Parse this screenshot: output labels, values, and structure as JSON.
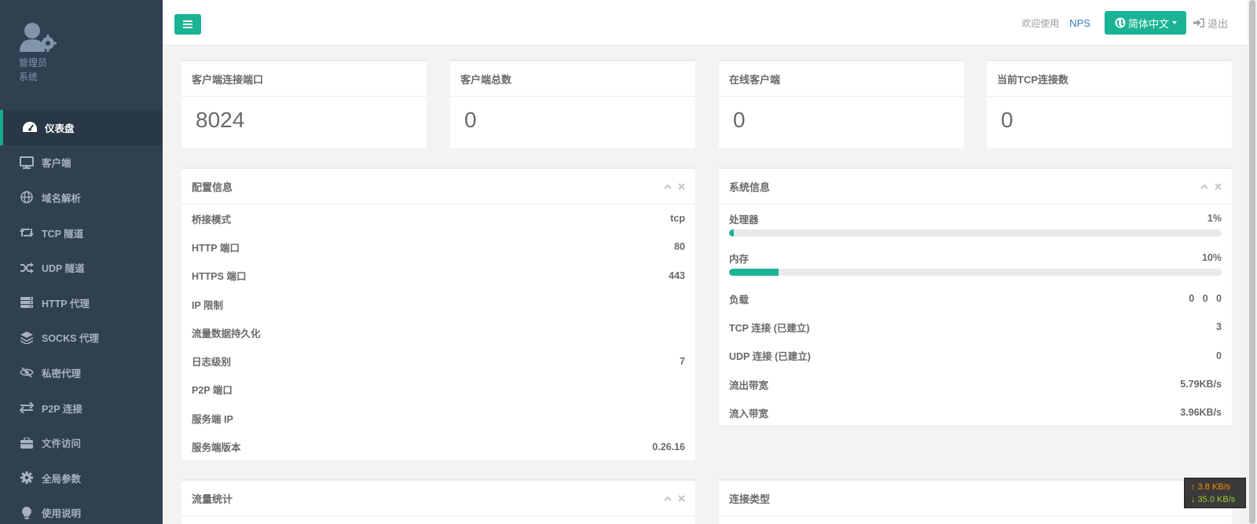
{
  "sidebar": {
    "profile": {
      "role": "管理员",
      "sub": "系统"
    },
    "items": [
      {
        "label": "仪表盘",
        "icon": "dashboard-icon"
      },
      {
        "label": "客户端",
        "icon": "monitor-icon"
      },
      {
        "label": "域名解析",
        "icon": "globe-icon"
      },
      {
        "label": "TCP 隧道",
        "icon": "retweet-icon"
      },
      {
        "label": "UDP 隧道",
        "icon": "shuffle-icon"
      },
      {
        "label": "HTTP 代理",
        "icon": "server-icon"
      },
      {
        "label": "SOCKS 代理",
        "icon": "layers-icon"
      },
      {
        "label": "私密代理",
        "icon": "eye-slash-icon"
      },
      {
        "label": "P2P 连接",
        "icon": "exchange-icon"
      },
      {
        "label": "文件访问",
        "icon": "briefcase-icon"
      },
      {
        "label": "全局参数",
        "icon": "gear-icon"
      },
      {
        "label": "使用说明",
        "icon": "lightbulb-icon"
      }
    ]
  },
  "topbar": {
    "welcome": "欢迎使用",
    "brand": "NPS",
    "language": "简体中文",
    "logout": "退出"
  },
  "stats": [
    {
      "title": "客户端连接端口",
      "value": "8024"
    },
    {
      "title": "客户端总数",
      "value": "0"
    },
    {
      "title": "在线客户端",
      "value": "0"
    },
    {
      "title": "当前TCP连接数",
      "value": "0"
    }
  ],
  "config": {
    "title": "配置信息",
    "rows": [
      {
        "label": "桥接模式",
        "value": "tcp"
      },
      {
        "label": "HTTP 端口",
        "value": "80"
      },
      {
        "label": "HTTPS 端口",
        "value": "443"
      },
      {
        "label": "IP 限制",
        "value": ""
      },
      {
        "label": "流量数据持久化",
        "value": ""
      },
      {
        "label": "日志级别",
        "value": "7"
      },
      {
        "label": "P2P 端口",
        "value": ""
      },
      {
        "label": "服务端 IP",
        "value": ""
      },
      {
        "label": "服务端版本",
        "value": "0.26.16"
      }
    ]
  },
  "system": {
    "title": "系统信息",
    "cpu": {
      "label": "处理器",
      "value": "1%",
      "percent": 1
    },
    "mem": {
      "label": "内存",
      "value": "10%",
      "percent": 10
    },
    "rows": [
      {
        "label": "负载",
        "value": "0   0   0"
      },
      {
        "label": "TCP 连接 (已建立)",
        "value": "3"
      },
      {
        "label": "UDP 连接 (已建立)",
        "value": "0"
      },
      {
        "label": "流出带宽",
        "value": "5.79KB/s"
      },
      {
        "label": "流入带宽",
        "value": "3.96KB/s"
      }
    ]
  },
  "traffic": {
    "title": "流量统计"
  },
  "conn_type": {
    "title": "连接类型"
  },
  "speed_widget": {
    "up": "↑ 3.8 KB/s",
    "down": "↓ 35.0 KB/s"
  },
  "colors": {
    "sidebar": "#2f4050",
    "accent": "#1ab394",
    "link": "#337ab7"
  }
}
